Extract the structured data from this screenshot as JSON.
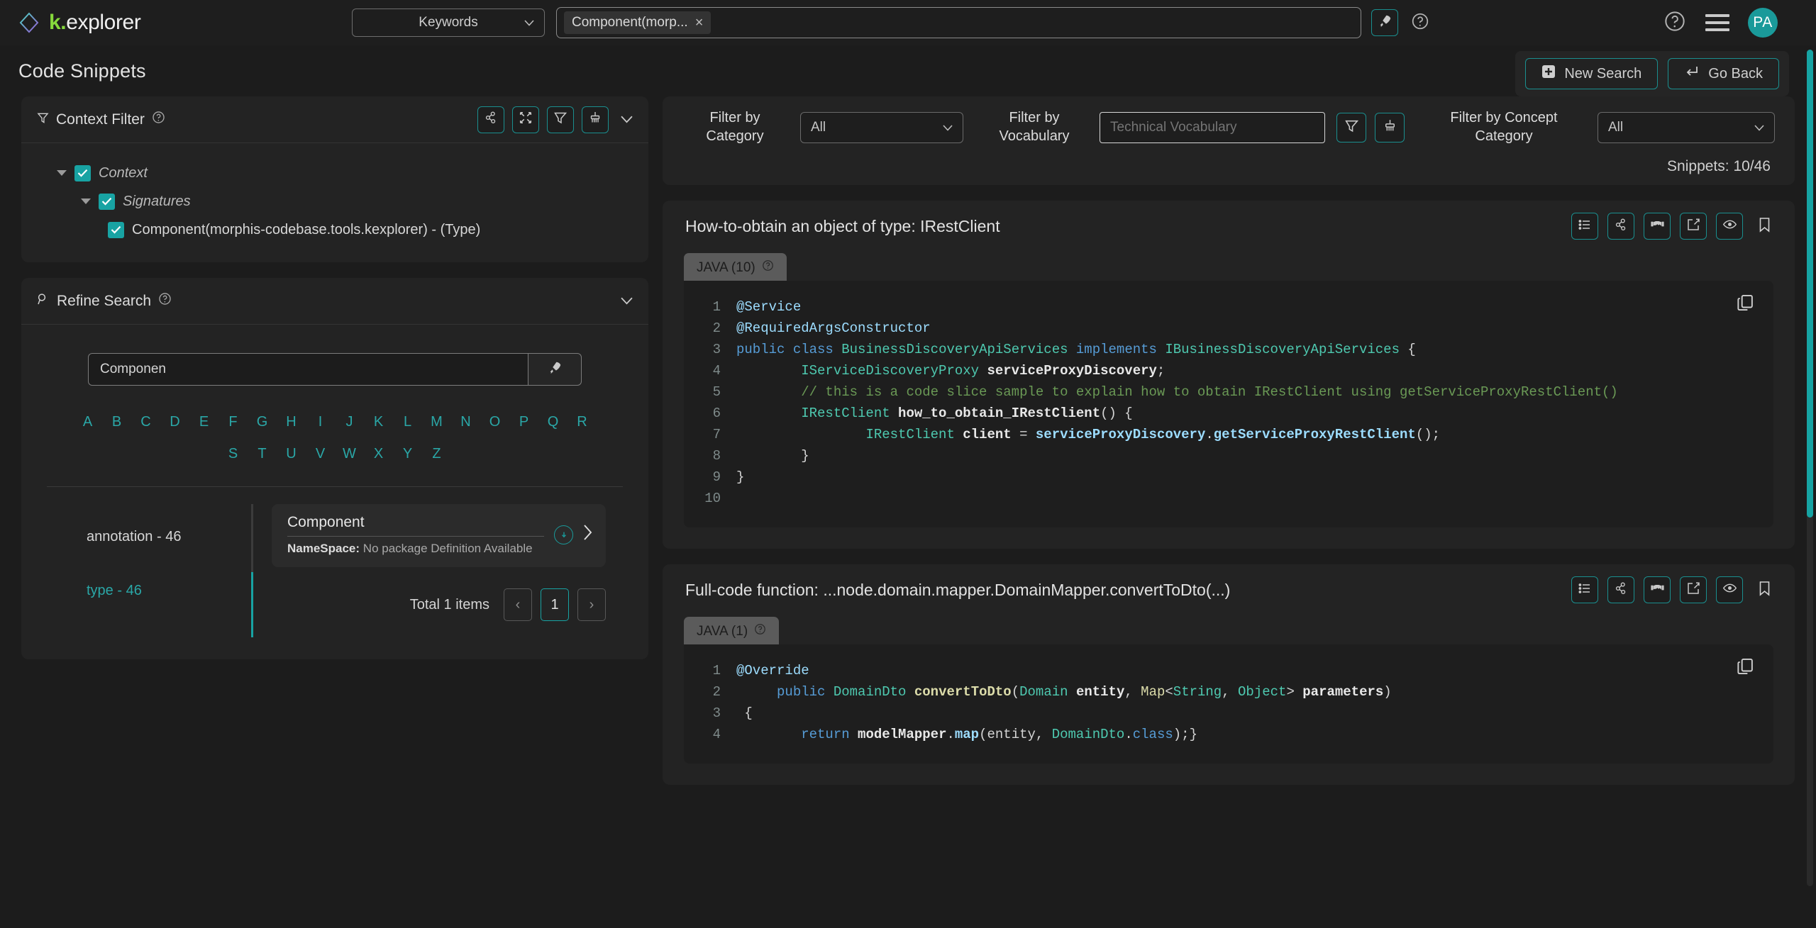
{
  "brand": {
    "prefix": "k.",
    "suffix": "explorer",
    "icon": "diamond-logo-icon"
  },
  "topbar": {
    "keyword_select": {
      "value": "Keywords",
      "icon": "chevron-down-icon"
    },
    "search_chip": {
      "label": "Component(morp...",
      "close": "×"
    },
    "rocket_icon": "rocket-search-icon",
    "help_icon_1": "help-circle-icon",
    "help_icon_2": "help-circle-icon",
    "menu_icon": "hamburger-menu-icon",
    "avatar_initials": "PA"
  },
  "page": {
    "title": "Code Snippets",
    "new_search_label": "New Search",
    "new_search_icon": "plus-square-icon",
    "go_back_label": "Go Back",
    "go_back_icon": "return-arrow-icon"
  },
  "context_filter": {
    "title": "Context Filter",
    "title_icon": "funnel-icon",
    "help_icon": "help-circle-icon",
    "actions": [
      {
        "name": "graph-nodes-icon"
      },
      {
        "name": "collapse-arrows-icon"
      },
      {
        "name": "funnel-icon"
      },
      {
        "name": "broom-clear-icon"
      }
    ],
    "collapse_icon": "chevron-down-icon",
    "tree": [
      {
        "label": "Context",
        "level": 0,
        "italic": true,
        "checked": true,
        "expandable": true
      },
      {
        "label": "Signatures",
        "level": 1,
        "italic": true,
        "checked": true,
        "expandable": true
      },
      {
        "label": "Component(morphis-codebase.tools.kexplorer) - (Type)",
        "level": 2,
        "italic": false,
        "checked": true,
        "expandable": false
      }
    ]
  },
  "refine_search": {
    "title": "Refine Search",
    "title_icon": "magnifier-icon",
    "help_icon": "help-circle-icon",
    "collapse_icon": "chevron-down-icon",
    "input_value": "Componen",
    "input_placeholder": "",
    "go_icon": "rocket-search-icon",
    "alphabet_row1": [
      "A",
      "B",
      "C",
      "D",
      "E",
      "F",
      "G",
      "H",
      "I",
      "J",
      "K",
      "L",
      "M",
      "N",
      "O",
      "P",
      "Q",
      "R"
    ],
    "alphabet_row2": [
      "S",
      "T",
      "U",
      "V",
      "W",
      "X",
      "Y",
      "Z"
    ],
    "facets": [
      {
        "label": "annotation - 46",
        "active": false
      },
      {
        "label": "type - 46",
        "active": true
      }
    ],
    "result": {
      "name": "Component",
      "namespace_label": "NameSpace:",
      "namespace_value": "No package Definition Available",
      "info_icon": "info-circle-icon",
      "open_icon": "chevron-right-icon"
    },
    "pagination": {
      "total_label": "Total 1 items",
      "prev": "‹",
      "current": "1",
      "next": "›"
    }
  },
  "filter_bar": {
    "category_label": "Filter by\nCategory",
    "category_label_1": "Filter by",
    "category_label_2": "Category",
    "category_value": "All",
    "vocabulary_label_1": "Filter by",
    "vocabulary_label_2": "Vocabulary",
    "vocabulary_value": "Technical Vocabulary",
    "vocabulary_placeholder": "Technical Vocabulary",
    "vocab_filter_icon": "funnel-icon",
    "vocab_clear_icon": "broom-clear-icon",
    "concept_label_1": "Filter by Concept",
    "concept_label_2": "Category",
    "concept_value": "All",
    "snippets_count": "Snippets: 10/46"
  },
  "snippet_actions": [
    {
      "name": "list-view-icon",
      "bordered": true
    },
    {
      "name": "graph-nodes-icon",
      "bordered": true
    },
    {
      "name": "handshake-icon",
      "bordered": true
    },
    {
      "name": "edit-square-icon",
      "bordered": true
    },
    {
      "name": "eye-visibility-icon",
      "bordered": true
    },
    {
      "name": "bookmark-icon",
      "bordered": false
    }
  ],
  "snippets": [
    {
      "title": "How-to-obtain an object of type: IRestClient",
      "lang_tab": "JAVA (10)",
      "lang_help_icon": "help-circle-icon",
      "copy_icon": "copy-icon",
      "lines": [
        {
          "n": "1",
          "tokens": [
            {
              "c": "m",
              "t": "@Service"
            }
          ]
        },
        {
          "n": "2",
          "tokens": [
            {
              "c": "m",
              "t": "@RequiredArgsConstructor"
            }
          ]
        },
        {
          "n": "3",
          "tokens": [
            {
              "c": "k",
              "t": "public "
            },
            {
              "c": "k",
              "t": "class "
            },
            {
              "c": "t",
              "t": "BusinessDiscoveryApiServices "
            },
            {
              "c": "k",
              "t": "implements "
            },
            {
              "c": "t",
              "t": "IBusinessDiscoveryApiServices "
            },
            {
              "c": "cd",
              "t": "{"
            }
          ]
        },
        {
          "n": "4",
          "tokens": [
            {
              "c": "cd",
              "t": "        "
            },
            {
              "c": "t",
              "t": "IServiceDiscoveryProxy "
            },
            {
              "c": "w",
              "t": "serviceProxyDiscovery"
            },
            {
              "c": "cd",
              "t": ";"
            }
          ]
        },
        {
          "n": "5",
          "tokens": [
            {
              "c": "cd",
              "t": "        "
            },
            {
              "c": "c",
              "t": "// this is a code slice sample to explain how to obtain IRestClient using getServiceProxyRestClient()"
            }
          ]
        },
        {
          "n": "6",
          "tokens": [
            {
              "c": "cd",
              "t": "        "
            },
            {
              "c": "t",
              "t": "IRestClient "
            },
            {
              "c": "w",
              "t": "how_to_obtain_IRestClient"
            },
            {
              "c": "cd",
              "t": "() {"
            }
          ]
        },
        {
          "n": "7",
          "tokens": [
            {
              "c": "cd",
              "t": "                "
            },
            {
              "c": "t",
              "t": "IRestClient "
            },
            {
              "c": "w",
              "t": "client "
            },
            {
              "c": "cd",
              "t": "= "
            },
            {
              "c": "m",
              "t": "serviceProxyDiscovery"
            },
            {
              "c": "cd",
              "t": "."
            },
            {
              "c": "m",
              "t": "getServiceProxyRestClient"
            },
            {
              "c": "cd",
              "t": "();"
            }
          ]
        },
        {
          "n": "8",
          "tokens": [
            {
              "c": "cd",
              "t": "        }"
            }
          ]
        },
        {
          "n": "9",
          "tokens": [
            {
              "c": "cd",
              "t": "}"
            }
          ]
        },
        {
          "n": "10",
          "tokens": [
            {
              "c": "cd",
              "t": ""
            }
          ]
        }
      ]
    },
    {
      "title": "Full-code function: ...node.domain.mapper.DomainMapper.convertToDto(...)",
      "lang_tab": "JAVA (1)",
      "lang_help_icon": "help-circle-icon",
      "copy_icon": "copy-icon",
      "lines": [
        {
          "n": "1",
          "tokens": [
            {
              "c": "m",
              "t": "@Override"
            }
          ]
        },
        {
          "n": "2",
          "tokens": [
            {
              "c": "cd",
              "t": "     "
            },
            {
              "c": "k",
              "t": "public "
            },
            {
              "c": "t",
              "t": "DomainDto "
            },
            {
              "c": "f",
              "t": "convertToDto"
            },
            {
              "c": "cd",
              "t": "("
            },
            {
              "c": "t",
              "t": "Domain "
            },
            {
              "c": "w",
              "t": "entity"
            },
            {
              "c": "cd",
              "t": ", "
            },
            {
              "c": "f",
              "t": "Map"
            },
            {
              "c": "cd",
              "t": "<"
            },
            {
              "c": "t",
              "t": "String"
            },
            {
              "c": "cd",
              "t": ", "
            },
            {
              "c": "t",
              "t": "Object"
            },
            {
              "c": "cd",
              "t": "> "
            },
            {
              "c": "w",
              "t": "parameters"
            },
            {
              "c": "cd",
              "t": ")"
            }
          ]
        },
        {
          "n": "3",
          "tokens": [
            {
              "c": "cd",
              "t": " {"
            }
          ]
        },
        {
          "n": "4",
          "tokens": [
            {
              "c": "cd",
              "t": "        "
            },
            {
              "c": "k",
              "t": "return "
            },
            {
              "c": "w",
              "t": "modelMapper"
            },
            {
              "c": "cd",
              "t": "."
            },
            {
              "c": "m",
              "t": "map"
            },
            {
              "c": "cd",
              "t": "(entity, "
            },
            {
              "c": "t",
              "t": "DomainDto"
            },
            {
              "c": "cd",
              "t": "."
            },
            {
              "c": "k",
              "t": "class"
            },
            {
              "c": "cd",
              "t": ");}"
            }
          ]
        }
      ]
    }
  ],
  "colors": {
    "accent_teal": "#18a3a3",
    "brand_green": "#86d93c",
    "panel_bg": "#232323",
    "page_bg": "#1c1c1c"
  }
}
